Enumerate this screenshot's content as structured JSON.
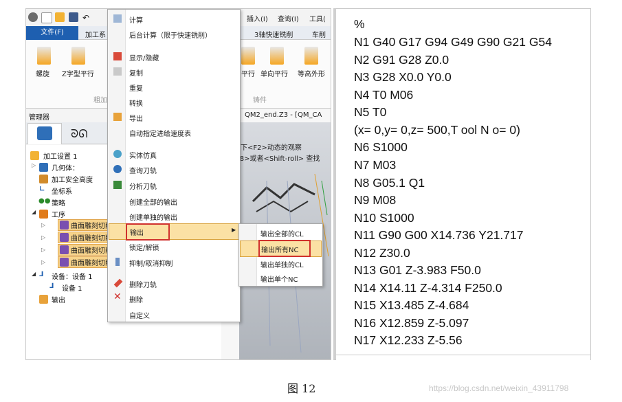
{
  "toolbar": {
    "menu_insert": "插入(I)",
    "menu_query": "查询(I)",
    "menu_tool": "工具("
  },
  "ribbon": {
    "tabs": [
      "文件(F)",
      "加工系",
      "3轴快速铣削",
      "车削"
    ],
    "buttons_left": [
      "螺旋",
      "Z字型平行"
    ],
    "buttons_right": [
      "平行",
      "单向平行",
      "等高外形"
    ],
    "group_left": "粗加",
    "group_right": "铸件"
  },
  "manager": {
    "title": "管理器",
    "tree": {
      "setup": "加工设置 1",
      "geometry": "几何体：",
      "safe_height": "加工安全高度",
      "coord": "坐标系",
      "strategy": "策略",
      "operations": "工序",
      "op_items": [
        "曲面雕刻切削",
        "曲面雕刻切削",
        "曲面雕刻切削",
        "曲面雕刻切削"
      ],
      "device_group": "设备：设备 1",
      "device": "设备 1",
      "output": "输出"
    }
  },
  "viewport": {
    "doc_tab": "QM2_end.Z3 - [QM_CA",
    "hint1": "下<F2>动态的观察",
    "hint2": "F8>或者<Shift-roll> 查找"
  },
  "context_menu": {
    "items": [
      "计算",
      "后台计算（限于快速铣削）",
      "显示/隐藏",
      "复制",
      "重复",
      "转换",
      "导出",
      "自动指定进给速度表",
      "实体仿真",
      "查询刀轨",
      "分析刀轨",
      "创建全部的输出",
      "创建单独的输出",
      "输出",
      "锁定/解锁",
      "抑制/取消抑制",
      "删除刀轨",
      "删除",
      "自定义"
    ]
  },
  "submenu": {
    "items": [
      "输出全部的CL",
      "输出所有NC",
      "输出单独的CL",
      "输出单个NC"
    ]
  },
  "nc_code": [
    "%",
    "N1 G40 G17 G94 G49 G90 G21 G54",
    "N2 G91 G28 Z0.0",
    "N3 G28 X0.0 Y0.0",
    "N4 T0 M06",
    "N5 T0",
    "(x= 0,y= 0,z= 500,T ool N o= 0)",
    "N6 S1000",
    "N7 M03",
    "N8 G05.1 Q1",
    "N9 M08",
    "N10 S1000",
    "N11 G90 G00 X14.736 Y21.717",
    "N12 Z30.0",
    "N13 G01 Z-3.983 F50.0",
    "N14 X14.11 Z-4.314 F250.0",
    "N15 X13.485 Z-4.684",
    "N16 X12.859 Z-5.097",
    "N17 X12.233 Z-5.56"
  ],
  "caption": "图 12",
  "watermark": "https://blog.csdn.net/weixin_43911798",
  "colors": {
    "tab_blue": "#1e5fb0",
    "highlight": "#fbe1a4",
    "highlight_border": "#d9a440",
    "red_box": "#d0312d"
  }
}
